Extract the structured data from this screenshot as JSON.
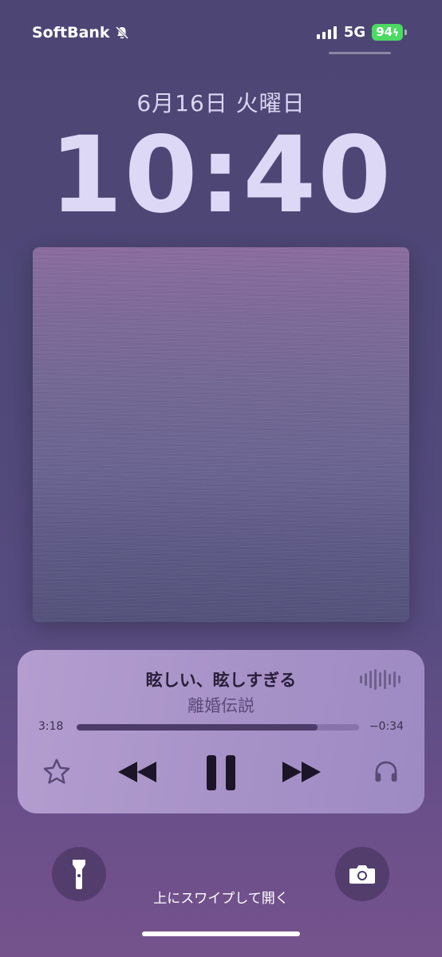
{
  "status_bar": {
    "carrier": "SoftBank",
    "network": "5G",
    "battery": "94"
  },
  "lock_screen": {
    "date": "6月16日 火曜日",
    "time": "10:40"
  },
  "now_playing": {
    "title": "眩しい、眩しすぎる",
    "artist": "離婚伝説",
    "elapsed": "3:18",
    "remaining": "−0:34",
    "progress_fraction": 0.853
  },
  "bottom": {
    "swipe_hint": "上にスワイプして開く"
  },
  "icons": {
    "mute": "bell-slash-icon",
    "signal": "cellular-signal-icon",
    "favorite": "star-icon",
    "rewind": "rewind-icon",
    "pause": "pause-icon",
    "fast_forward": "fast-forward-icon",
    "airplay": "headphones-icon",
    "flashlight": "flashlight-icon",
    "camera": "camera-icon",
    "waveform": "waveform-icon"
  },
  "colors": {
    "battery_green": "#4cd964",
    "player_bg": "#a893c8"
  }
}
